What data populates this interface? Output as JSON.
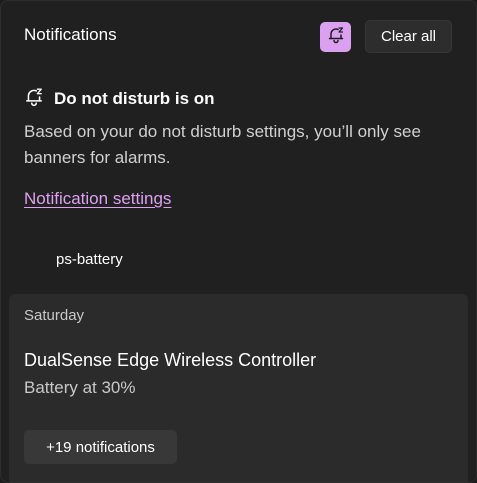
{
  "header": {
    "title": "Notifications",
    "dnd_icon": "bell-snooze-icon",
    "clear_all_label": "Clear all"
  },
  "dnd_banner": {
    "icon": "bell-snooze-icon",
    "title": "Do not disturb is on",
    "description": "Based on your do not disturb settings, you’ll only see banners for alarms."
  },
  "settings_link": "Notification settings",
  "app_group": {
    "name": "ps-battery"
  },
  "notification": {
    "date": "Saturday",
    "title": "DualSense Edge Wireless Controller",
    "body": "Battery at 30%",
    "more_label": "+19 notifications"
  },
  "colors": {
    "accent": "#dca0f0",
    "background": "#202020",
    "card": "#2b2b2b"
  }
}
